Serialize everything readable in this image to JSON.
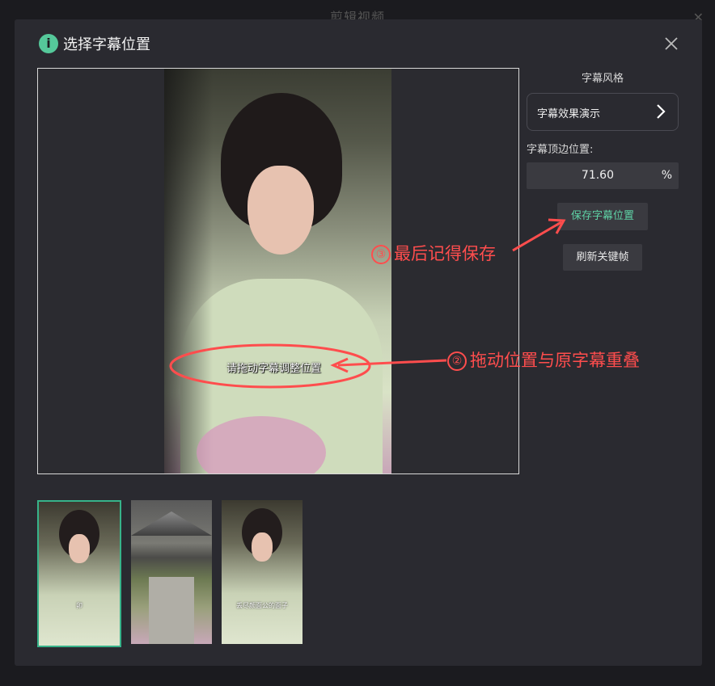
{
  "background": {
    "title": "剪辑视频"
  },
  "dialog": {
    "title": "选择字幕位置",
    "info_icon": "info-icon",
    "close_icon": "close-icon"
  },
  "preview": {
    "draggable_subtitle": "请拖动字幕调整位置"
  },
  "right_panel": {
    "style_label": "字幕风格",
    "style_button": "字幕效果演示",
    "position_label": "字幕顶边位置:",
    "position_value": "71.60",
    "position_unit": "%",
    "save_button": "保存字幕位置",
    "refresh_button": "刷新关键帧"
  },
  "annotations": {
    "step3_num": "③",
    "step3_text": "最后记得保存",
    "step2_num": "②",
    "step2_text": "拖动位置与原字幕重叠"
  },
  "thumbnails": [
    {
      "caption": "卯",
      "selected": true
    },
    {
      "caption": "",
      "selected": false
    },
    {
      "caption": "丢尽颜面公的面子",
      "selected": false
    }
  ],
  "colors": {
    "accent": "#55c89a",
    "annotation": "#ff4d4d",
    "save_text": "#5fd3a6"
  }
}
